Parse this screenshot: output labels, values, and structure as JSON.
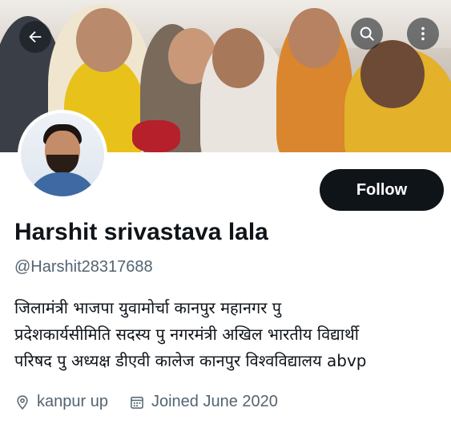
{
  "profile": {
    "display_name": "Harshit srivastava lala",
    "handle": "@Harshit28317688",
    "bio_lines": [
      "जिलामंत्री भाजपा युवामोर्चा कानपुर महानगर  पु",
      "प्रदेशकार्यसीमिति सदस्य पु नगरमंत्री अखिल भारतीय विद्यार्थी",
      "परिषद पु अध्यक्ष डीएवी कालेज कानपुर विश्वविद्यालय abvp"
    ],
    "location": "kanpur up",
    "joined": "Joined June 2020"
  },
  "actions": {
    "follow_label": "Follow"
  },
  "icons": {
    "back": "arrow-left-icon",
    "search": "search-icon",
    "more": "more-icon",
    "location": "location-pin-icon",
    "calendar": "calendar-icon"
  },
  "colors": {
    "follow_bg": "#0f1419",
    "secondary_text": "#536471"
  }
}
